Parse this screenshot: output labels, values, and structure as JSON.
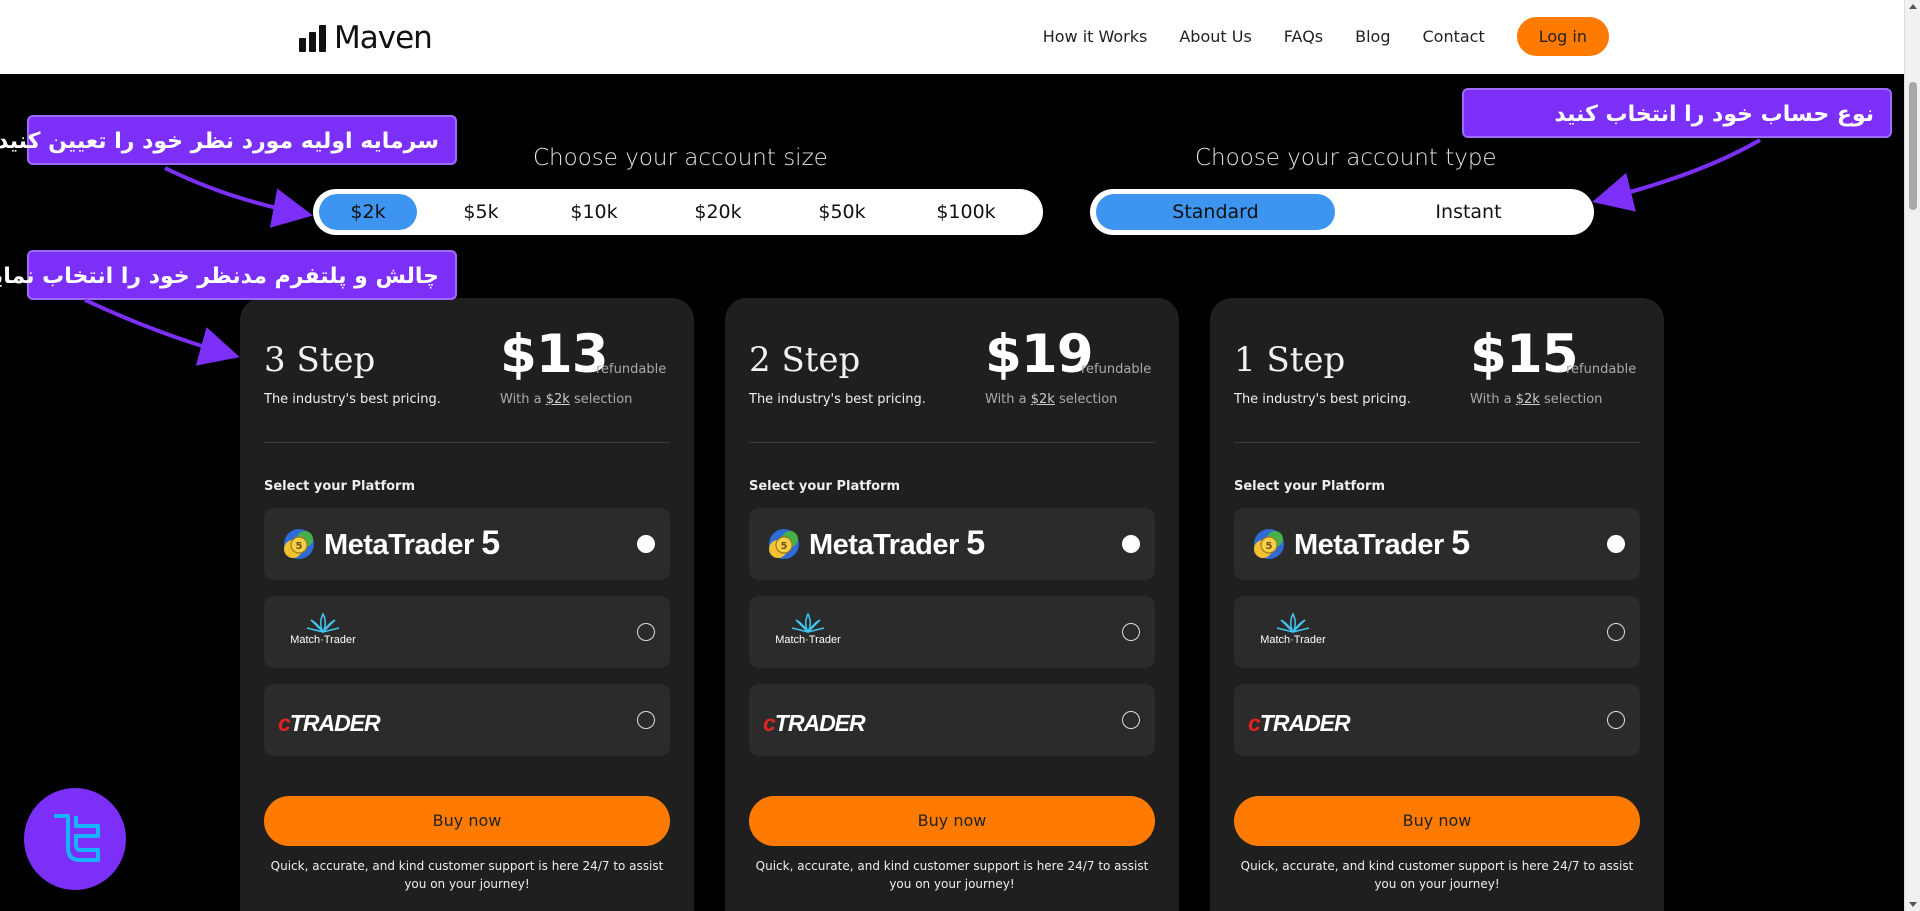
{
  "header": {
    "brand": "Maven",
    "nav": [
      "How it Works",
      "About Us",
      "FAQs",
      "Blog",
      "Contact"
    ],
    "login_label": "Log in"
  },
  "account_size": {
    "title": "Choose your account size",
    "options": [
      "$2k",
      "$5k",
      "$10k",
      "$20k",
      "$50k",
      "$100k"
    ],
    "selected": "$2k"
  },
  "account_type": {
    "title": "Choose your account type",
    "options": [
      "Standard",
      "Instant"
    ],
    "selected": "Standard"
  },
  "annotations": {
    "size_note": "سرمایه اولیه مورد نظر خود را تعیین کنید",
    "type_note": "نوع حساب خود را انتخاب کنید",
    "platform_note": "چالش و پلتفرم مدنظر خود را انتخاب نمایید"
  },
  "cards": [
    {
      "step": "3 Step",
      "tagline": "The industry's best pricing.",
      "price": "$13",
      "refund": "refundable",
      "with_prefix": "With a",
      "with_size": "$2k",
      "with_suffix": "selection",
      "platform_label": "Select your Platform",
      "platforms": [
        "MetaTrader 5",
        "Match-Trader",
        "cTrader"
      ],
      "buy_label": "Buy now",
      "support_text": "Quick, accurate, and kind customer support is here 24/7 to assist you on your journey!"
    },
    {
      "step": "2 Step",
      "tagline": "The industry's best pricing.",
      "price": "$19",
      "refund": "refundable",
      "with_prefix": "With a",
      "with_size": "$2k",
      "with_suffix": "selection",
      "platform_label": "Select your Platform",
      "platforms": [
        "MetaTrader 5",
        "Match-Trader",
        "cTrader"
      ],
      "buy_label": "Buy now",
      "support_text": "Quick, accurate, and kind customer support is here 24/7 to assist you on your journey!"
    },
    {
      "step": "1 Step",
      "tagline": "The industry's best pricing.",
      "price": "$15",
      "refund": "refundable",
      "with_prefix": "With a",
      "with_size": "$2k",
      "with_suffix": "selection",
      "platform_label": "Select your Platform",
      "platforms": [
        "MetaTrader 5",
        "Match-Trader",
        "cTrader"
      ],
      "buy_label": "Buy now",
      "support_text": "Quick, accurate, and kind customer support is here 24/7 to assist you on your journey!"
    }
  ],
  "logo_text": {
    "mt5_name": "MetaTrader",
    "mt5_version": "5",
    "match": "Match·Trader",
    "ctrader_c": "c",
    "ctrader_rest": "TRADER"
  },
  "colors": {
    "accent_orange": "#ff7a00",
    "active_blue": "#3d95f0",
    "annotation_purple": "#7b2ff7",
    "card_bg": "#1f1f1f"
  }
}
